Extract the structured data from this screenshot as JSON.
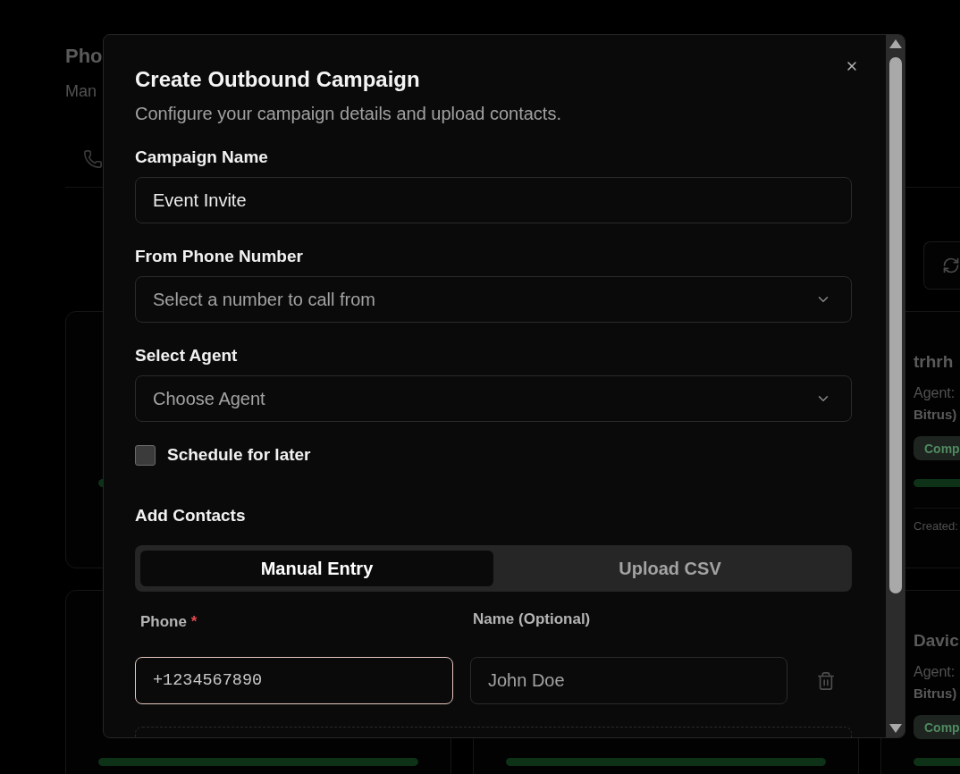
{
  "page": {
    "title": "Pho",
    "subtitle": "Man"
  },
  "card_rows": [
    [
      {
        "progress": {
          "level": 1
        }
      },
      {
        "name": "trhrh",
        "agent_label": "Agent:",
        "agent_name": "Bitrus)",
        "status": "Comp",
        "progress": {
          "level": 1
        },
        "created": "Created:"
      }
    ],
    [
      {
        "progress": {
          "level": 1
        }
      },
      {
        "progress": {
          "level": 1
        }
      },
      {
        "name": "Davic",
        "agent_label": "Agent:",
        "agent_name": "Bitrus)",
        "status": "Comp",
        "progress": {
          "level": 1
        }
      }
    ]
  ],
  "dialog": {
    "title": "Create Outbound Campaign",
    "description": "Configure your campaign details and upload contacts.",
    "fields": [
      {
        "kind": "text",
        "label": "Campaign Name",
        "value": "Event Invite"
      },
      {
        "kind": "select",
        "label": "From Phone Number",
        "placeholder": "Select a number to call from"
      },
      {
        "kind": "select",
        "label": "Select Agent",
        "placeholder": "Choose Agent"
      }
    ],
    "schedule": {
      "label": "Schedule for later",
      "checked": false
    },
    "contacts": {
      "title": "Add Contacts",
      "tabs": [
        {
          "label": "Manual Entry",
          "selected": true
        },
        {
          "label": "Upload CSV",
          "selected": false
        }
      ],
      "columns": [
        {
          "label": "Phone",
          "required_mark": "*"
        },
        {
          "label": "Name (Optional)"
        }
      ],
      "rows": [
        {
          "phone": {
            "placeholder": "+1234567890",
            "focused": true
          },
          "name": {
            "placeholder": "John Doe",
            "focused": false
          }
        }
      ]
    }
  }
}
